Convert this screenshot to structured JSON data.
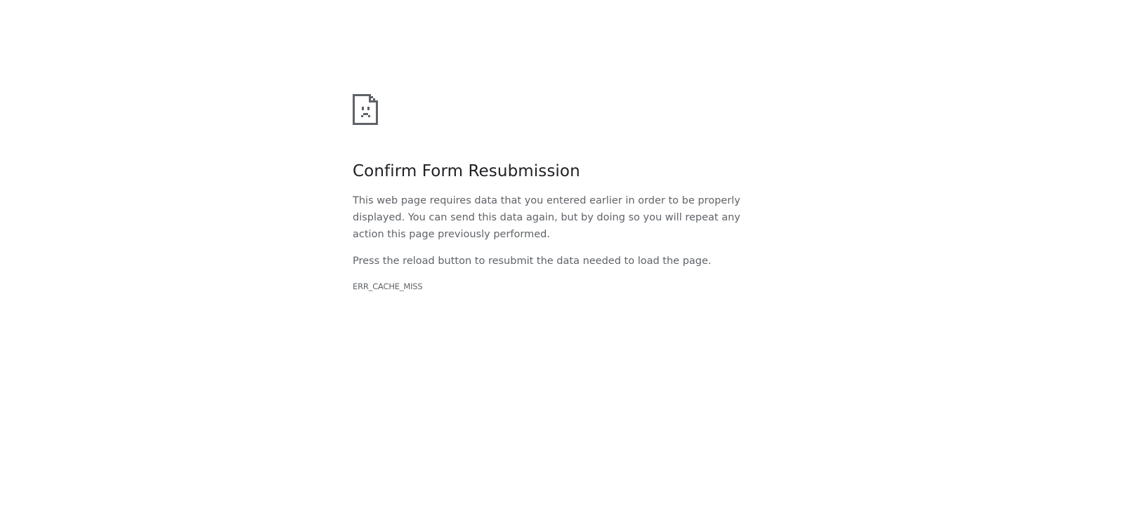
{
  "error_page": {
    "icon": "sad-page-icon",
    "title": "Confirm Form Resubmission",
    "paragraphs": [
      "This web page requires data that you entered earlier in order to be properly displayed. You can send this data again, but by doing so you will repeat any action this page previously performed.",
      "Press the reload button to resubmit the data needed to load the page."
    ],
    "error_code": "ERR_CACHE_MISS",
    "colors": {
      "background": "#ffffff",
      "title": "#202124",
      "body_text": "#5f6368",
      "icon": "#5f6368"
    }
  }
}
